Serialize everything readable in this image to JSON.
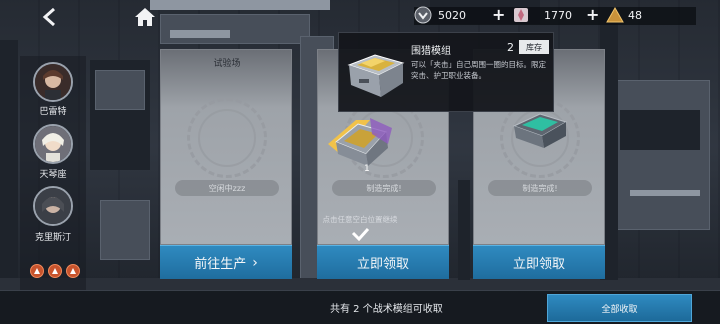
{
  "resources": [
    {
      "icon": "core-icon",
      "value": "5020"
    },
    {
      "icon": "tile-icon",
      "value": "1770"
    },
    {
      "icon": "ammo-icon",
      "value": "48"
    }
  ],
  "echelon": {
    "dolls": [
      {
        "name": "巴雷特"
      },
      {
        "name": "天琴座"
      },
      {
        "name": "克里斯汀"
      }
    ]
  },
  "cards": [
    {
      "title": "试验场",
      "status": "空闲中zzz",
      "button": "前往生产",
      "button_arrow": "›"
    },
    {
      "title": "",
      "status": "制造完成!",
      "button": "立即领取",
      "reward_count": "1"
    },
    {
      "title": "",
      "status": "制造完成!",
      "button": "立即领取"
    }
  ],
  "popup": {
    "name": "围猎模组",
    "count": "2",
    "button": "库存",
    "description": "可以「夹击」自己周围一圈的目标。限定突击、护卫职业装备。"
  },
  "hint": "点击任意空白位置继续",
  "footer": {
    "summary": "共有 2 个战术模组可收取",
    "collect_all": "全部收取"
  },
  "colors": {
    "accent_blue": "#2f8ac0",
    "popup_bg": "#14161b"
  }
}
